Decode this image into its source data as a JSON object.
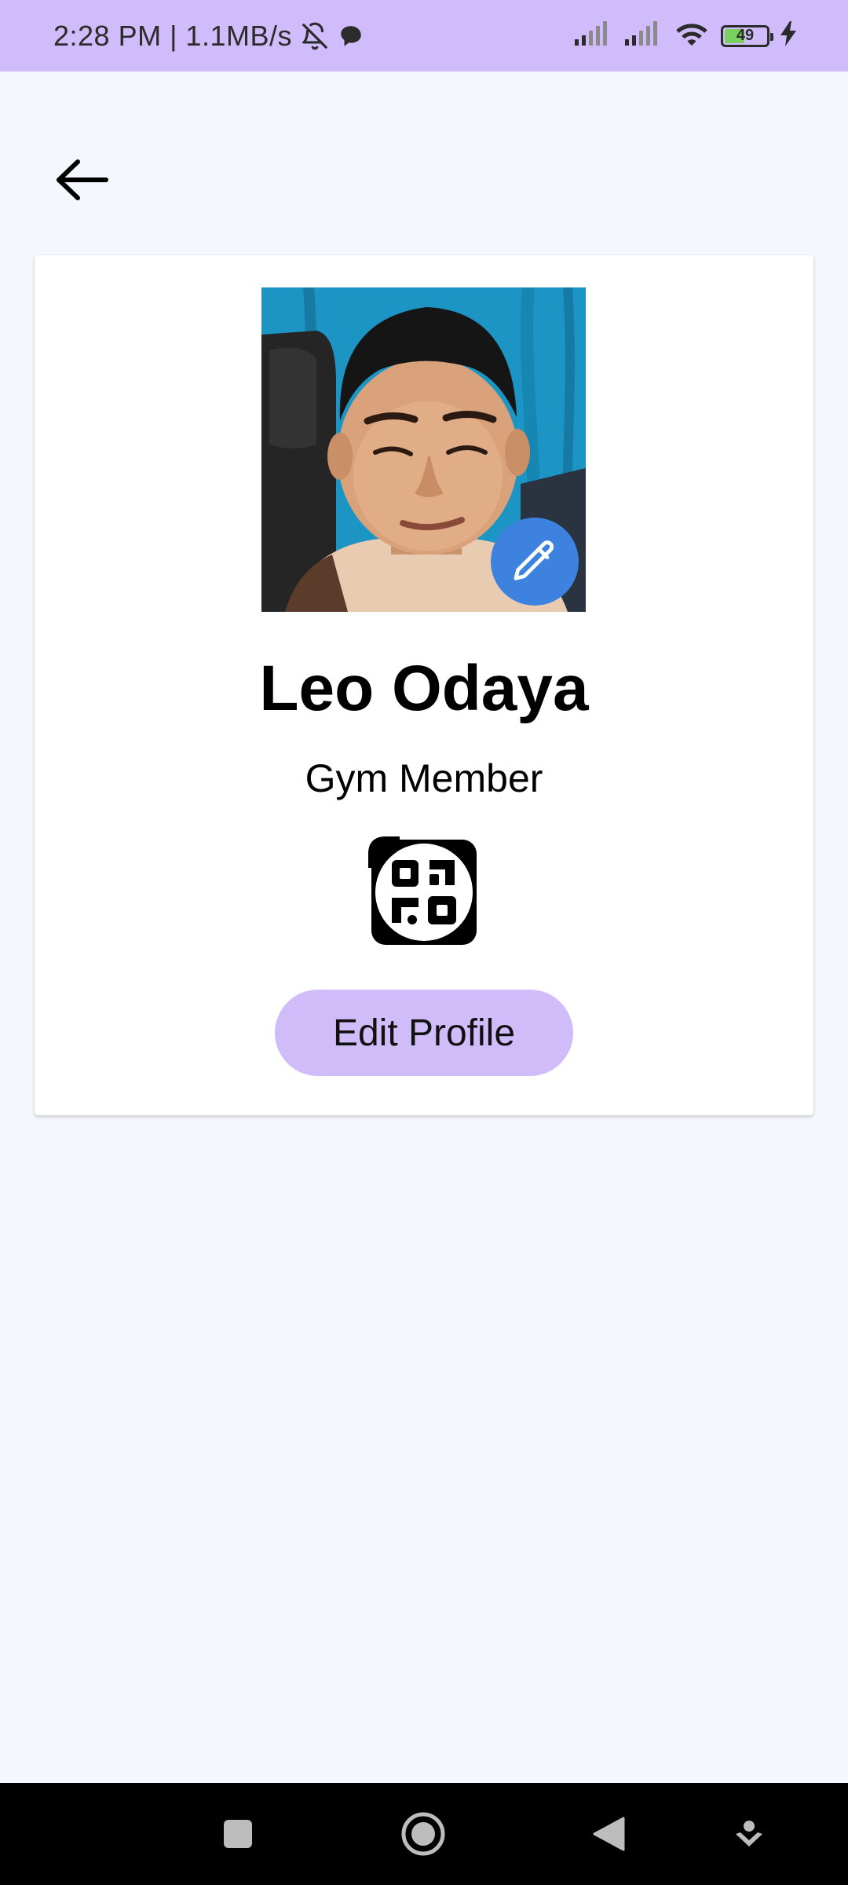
{
  "status_bar": {
    "time_speed": "2:28 PM | 1.1MB/s",
    "battery_level": "49",
    "battery_fraction": 0.49,
    "icons": [
      "bell-off-icon",
      "chat-bubble-icon",
      "signal-icon",
      "signal-icon",
      "wifi-icon",
      "battery-icon",
      "charging-icon"
    ]
  },
  "header": {
    "back_icon": "arrow-left-icon"
  },
  "profile": {
    "name": "Leo Odaya",
    "role": "Gym Member",
    "edit_button_label": "Edit Profile",
    "photo_edit_icon": "pencil-icon",
    "qr_icon": "qr-code-icon"
  },
  "colors": {
    "status_bar_bg": "#d0bcfa",
    "page_bg": "#f5f7fe",
    "card_bg": "#ffffff",
    "button_bg": "#d0bcf8",
    "photo_edit_bg": "#3e82e0",
    "nav_bar_bg": "#000000"
  },
  "nav_bar": {
    "items": [
      "recents-square-icon",
      "home-circle-icon",
      "back-triangle-icon",
      "assistant-icon"
    ]
  }
}
